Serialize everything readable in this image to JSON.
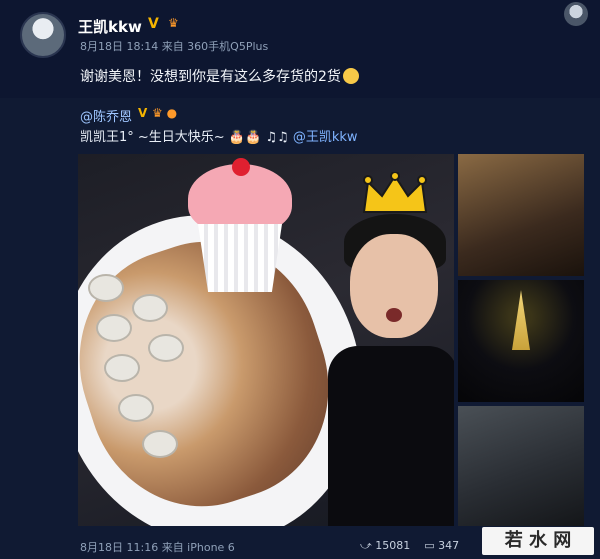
{
  "post": {
    "username": "王凯kkw",
    "verified": "V",
    "level_icon": "crown-level-icon",
    "meta": "8月18日 18:14 来自 360手机Q5Plus",
    "text": "谢谢美恩！没想到你是有这么多存货的2货",
    "emoji": "laughing-emoji"
  },
  "repost": {
    "username": "@陈乔恩",
    "verified": "V",
    "text_prefix": "凯凯王1° ~生日大快乐~",
    "mention": "@王凯kkw",
    "meta": "8月18日 11:16 来自 iPhone 6",
    "actions": {
      "count1": "15081",
      "count2": "347"
    }
  },
  "watermark": {
    "text": "若 水 网"
  },
  "colors": {
    "background": "#0a1226",
    "link": "#7fb3ff",
    "badge": "#f5b400"
  }
}
